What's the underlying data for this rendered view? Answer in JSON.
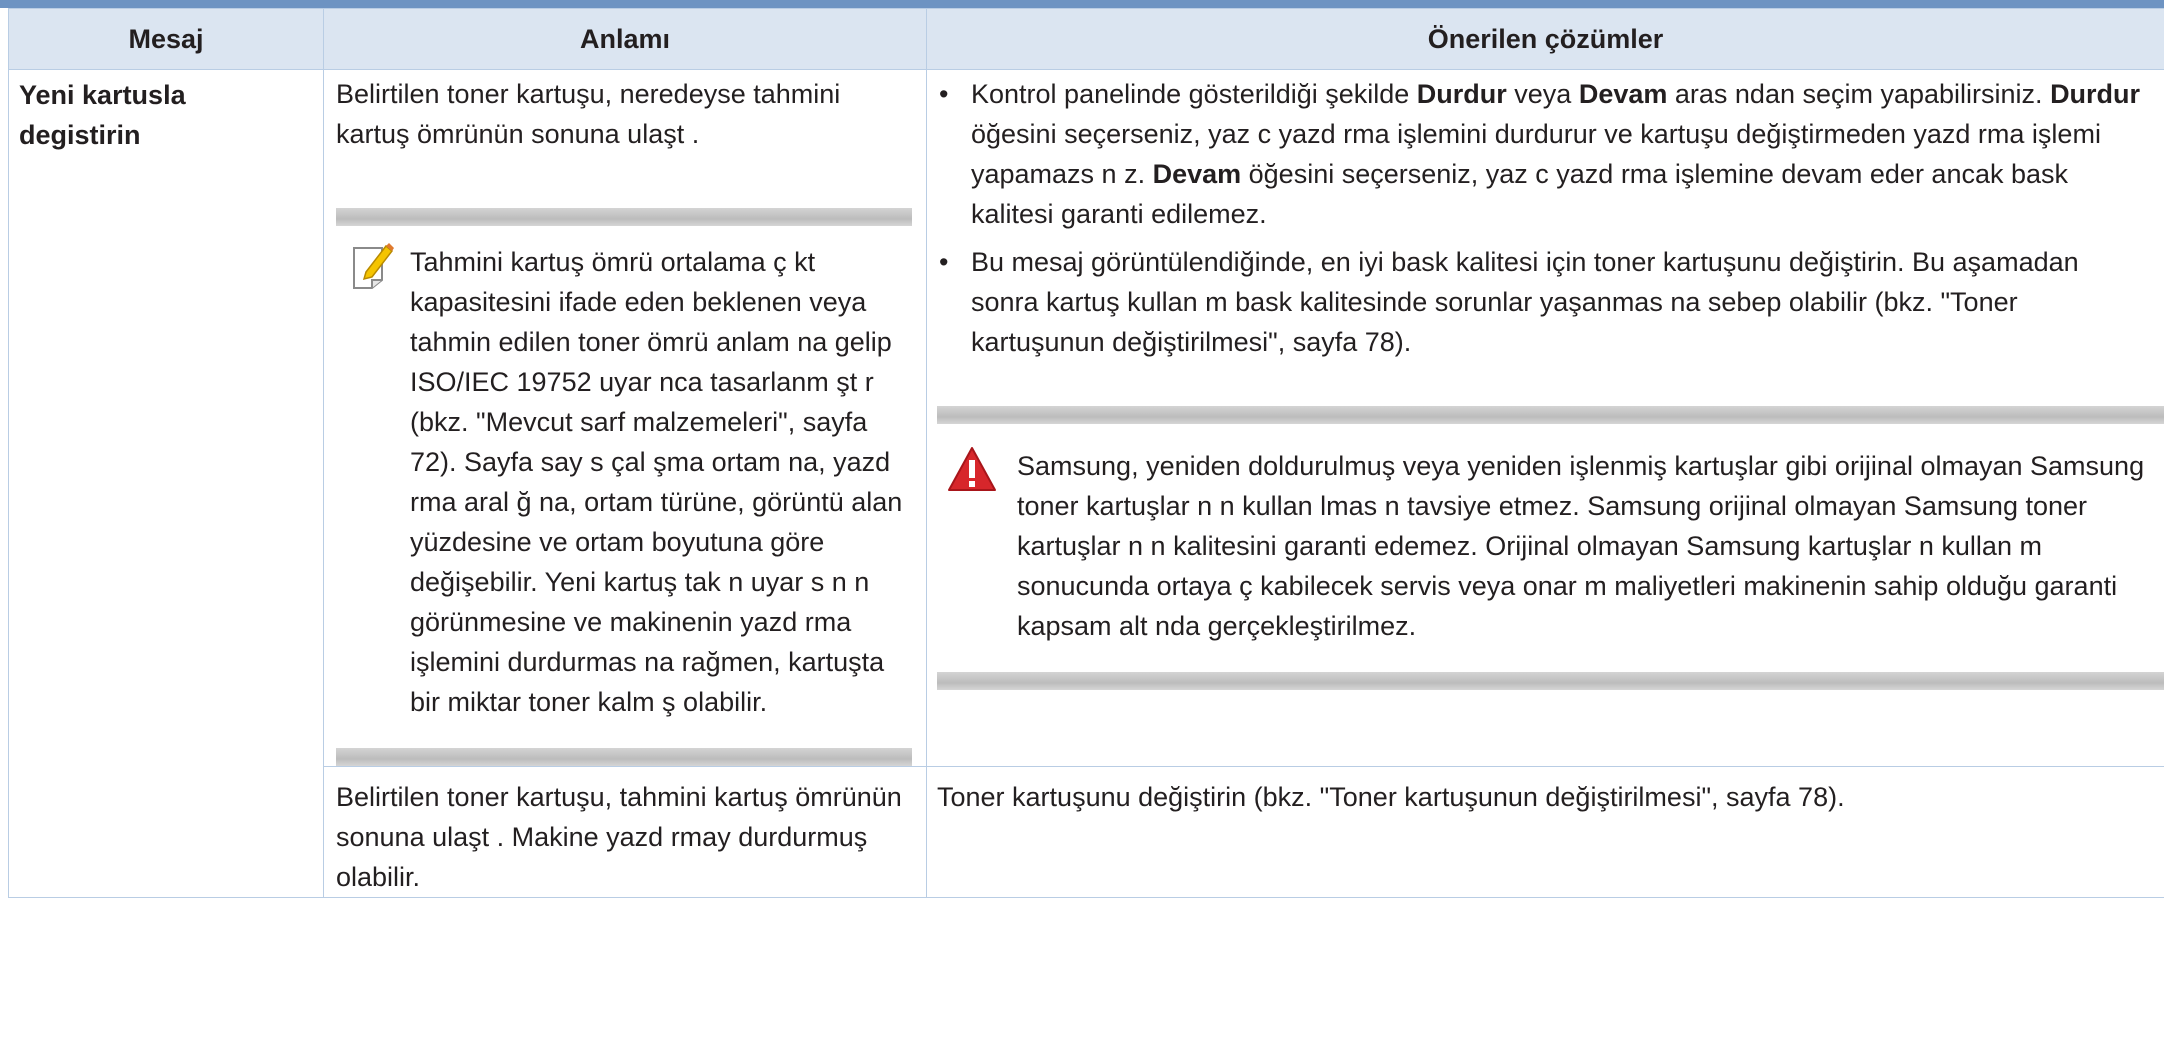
{
  "headers": {
    "message": "Mesaj",
    "meaning": "Anlamı",
    "solutions": "Önerilen çözümler"
  },
  "rows": [
    {
      "message": "Yeni kartusla degistirin",
      "meaning": "Belirtilen toner kartuşu, neredeyse tahmini kartuş ömrünün sonuna ulaşt .",
      "note": {
        "icon": "note-pencil-icon",
        "text": "Tahmini kartuş ömrü ortalama ç kt kapasitesini ifade eden beklenen veya tahmin edilen toner ömrü anlam na gelip ISO/IEC 19752 uyar nca tasarlanm şt r (bkz. \"Mevcut sarf malzemeleri\", sayfa 72). Sayfa say s çal şma ortam na, yazd rma aral ğ na, ortam türüne, görüntü alan yüzdesine ve ortam boyutuna göre değişebilir. Yeni kartuş tak n uyar s n n görünmesine ve makinenin yazd rma işlemini durdurmas na rağmen, kartuşta bir miktar toner kalm ş olabilir."
      },
      "solutions": {
        "bullet_1": {
          "part_1": "Kontrol panelinde gösterildiği şekilde ",
          "bold_1": "Durdur",
          "part_2": " veya ",
          "bold_2": "Devam",
          "part_3": " aras ndan seçim yapabilirsiniz. ",
          "bold_3": "Durdur",
          "part_4": " öğesini seçerseniz, yaz c yazd rma işlemini durdurur ve kartuşu değiştirmeden yazd rma işlemi yapamazs n z. ",
          "bold_4": "Devam",
          "part_5": " öğesini seçerseniz, yaz c yazd rma işlemine devam eder ancak bask kalitesi garanti edilemez."
        },
        "bullet_2": "Bu mesaj görüntülendiğinde, en iyi bask kalitesi için toner kartuşunu değiştirin. Bu aşamadan sonra kartuş kullan m bask kalitesinde sorunlar yaşanmas na sebep olabilir (bkz. \"Toner kartuşunun değiştirilmesi\", sayfa 78).",
        "warning": {
          "icon": "warning-icon",
          "text": "Samsung, yeniden doldurulmuş veya yeniden işlenmiş kartuşlar gibi orijinal olmayan Samsung toner kartuşlar n n kullan lmas n tavsiye etmez. Samsung orijinal olmayan Samsung toner kartuşlar n n kalitesini garanti edemez. Orijinal olmayan Samsung kartuşlar n kullan m sonucunda ortaya ç kabilecek servis veya onar m maliyetleri makinenin sahip olduğu garanti kapsam alt nda gerçekleştirilmez."
        }
      }
    },
    {
      "message": "",
      "meaning": "Belirtilen toner kartuşu, tahmini kartuş ömrünün sonuna ulaşt . Makine yazd rmay durdurmuş olabilir.",
      "solution": "Toner kartuşunu değiştirin (bkz. \"Toner kartuşunun değiştirilmesi\", sayfa 78)."
    }
  ],
  "colors": {
    "header_bg": "#dbe5f1",
    "border": "#b9cde4",
    "top_rule": "#6d93c2",
    "warning_red": "#d7262b"
  }
}
